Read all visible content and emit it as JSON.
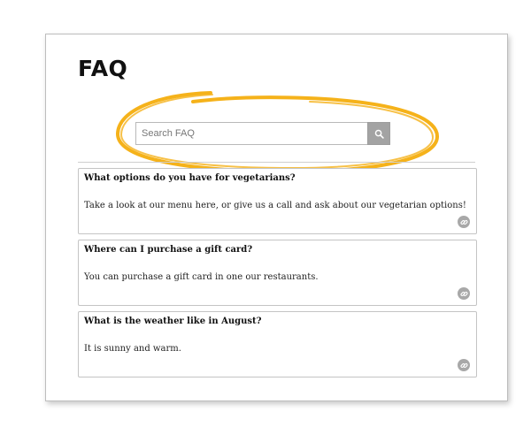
{
  "page": {
    "title": "FAQ"
  },
  "search": {
    "placeholder": "Search FAQ",
    "value": "",
    "button_icon": "search-icon",
    "highlight_color": "#f5b21a"
  },
  "faq": {
    "items": [
      {
        "question": "What options do you have for vegetarians?",
        "answer": "Take a look at our menu here, or give us a call and ask about our vegetarian options!",
        "icon": "link-icon"
      },
      {
        "question": "Where can I purchase a gift card?",
        "answer": "You can purchase a gift card in one our restaurants.",
        "icon": "link-icon"
      },
      {
        "question": "What is the weather like in August?",
        "answer": "It is sunny and warm.",
        "icon": "link-icon"
      }
    ]
  }
}
